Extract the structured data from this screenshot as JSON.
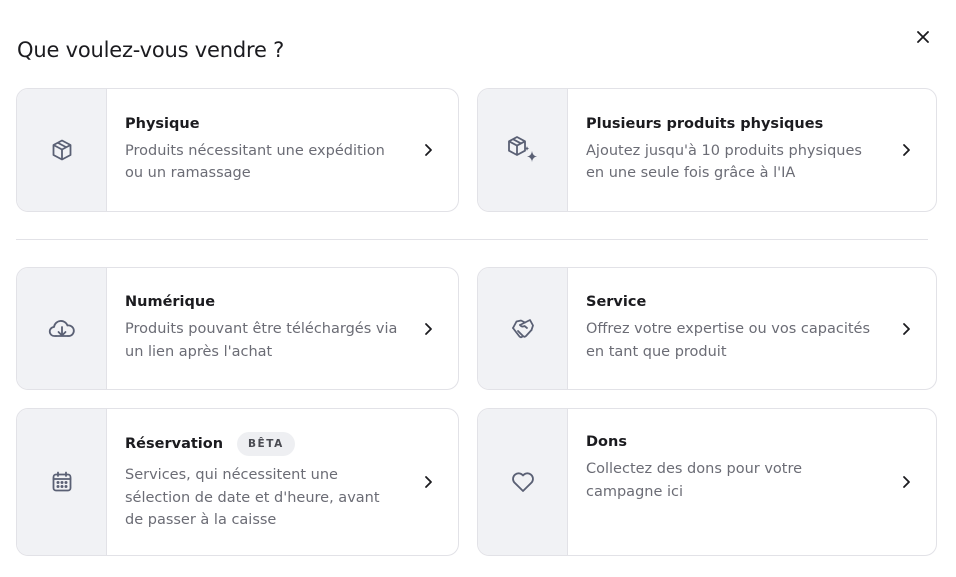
{
  "modal": {
    "title": "Que voulez-vous vendre ?"
  },
  "cards": [
    {
      "title": "Physique",
      "description": "Produits nécessitant une expédition ou un ramassage",
      "icon": "box-icon"
    },
    {
      "title": "Plusieurs produits physiques",
      "description": "Ajoutez jusqu'à 10 produits physiques en une seule fois grâce à l'IA",
      "icon": "box-sparkle-icon"
    },
    {
      "title": "Numérique",
      "description": "Produits pouvant être téléchargés via un lien après l'achat",
      "icon": "cloud-download-icon"
    },
    {
      "title": "Service",
      "description": "Offrez votre expertise ou vos capacités en tant que produit",
      "icon": "handshake-icon"
    },
    {
      "title": "Réservation",
      "badge": "BÊTA",
      "description": "Services, qui nécessitent une sélection de date et d'heure, avant de passer à la caisse",
      "icon": "calendar-icon"
    },
    {
      "title": "Dons",
      "description": "Collectez des dons pour votre campagne ici",
      "icon": "heart-icon"
    }
  ],
  "colors": {
    "text": "#1b1b1f",
    "muted": "#6b6c75",
    "border": "#e2e2e7",
    "icon_bg": "#f1f2f5",
    "icon": "#5a6074"
  }
}
